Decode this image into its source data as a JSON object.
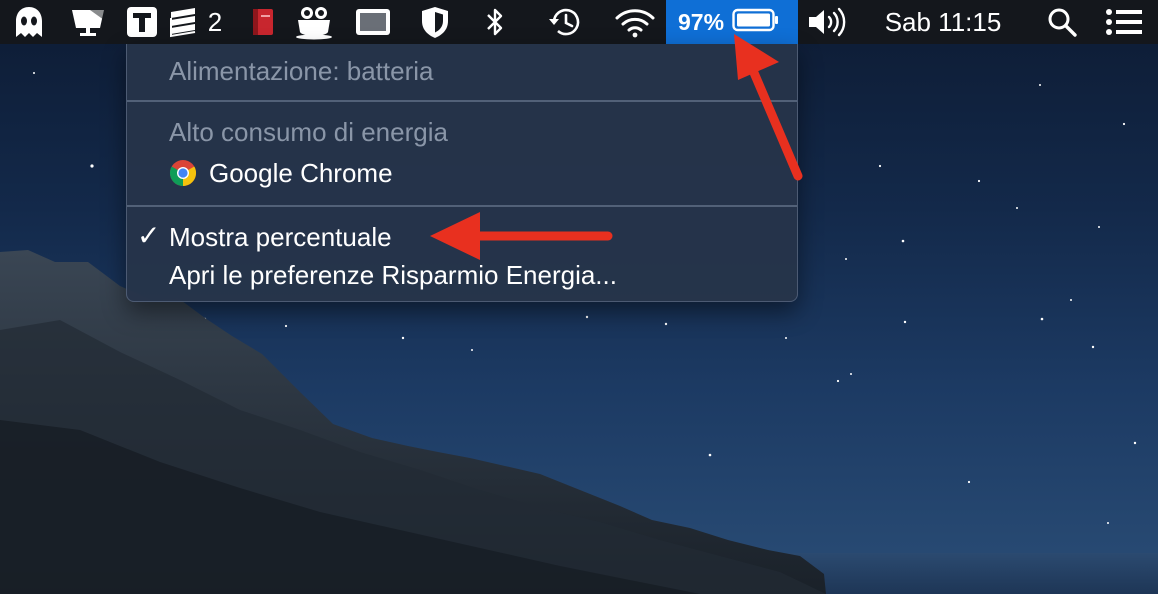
{
  "menubar": {
    "badge_count": "2",
    "battery_percent": "97%",
    "clock": "Sab 11:15",
    "icons": [
      "ghost-icon",
      "display-icon",
      "typora-icon",
      "layers-icon",
      "notebook-icon",
      "owl-cup-icon",
      "screen-icon",
      "shield-icon",
      "bluetooth-icon",
      "time-machine-icon",
      "wifi-icon",
      "battery-icon",
      "volume-icon",
      "search-icon",
      "list-icon"
    ]
  },
  "battery_menu": {
    "power_source": "Alimentazione: batteria",
    "high_energy_header": "Alto consumo di energia",
    "high_energy_app": "Google Chrome",
    "show_percentage": "Mostra percentuale",
    "show_percentage_checked": true,
    "check_mark": "✓",
    "open_preferences": "Apri le preferenze Risparmio Energia..."
  },
  "colors": {
    "menubar_bg": "#14171c",
    "highlight": "#0f6fd6",
    "menu_bg": "#26344a",
    "arrow": "#e8301f"
  }
}
